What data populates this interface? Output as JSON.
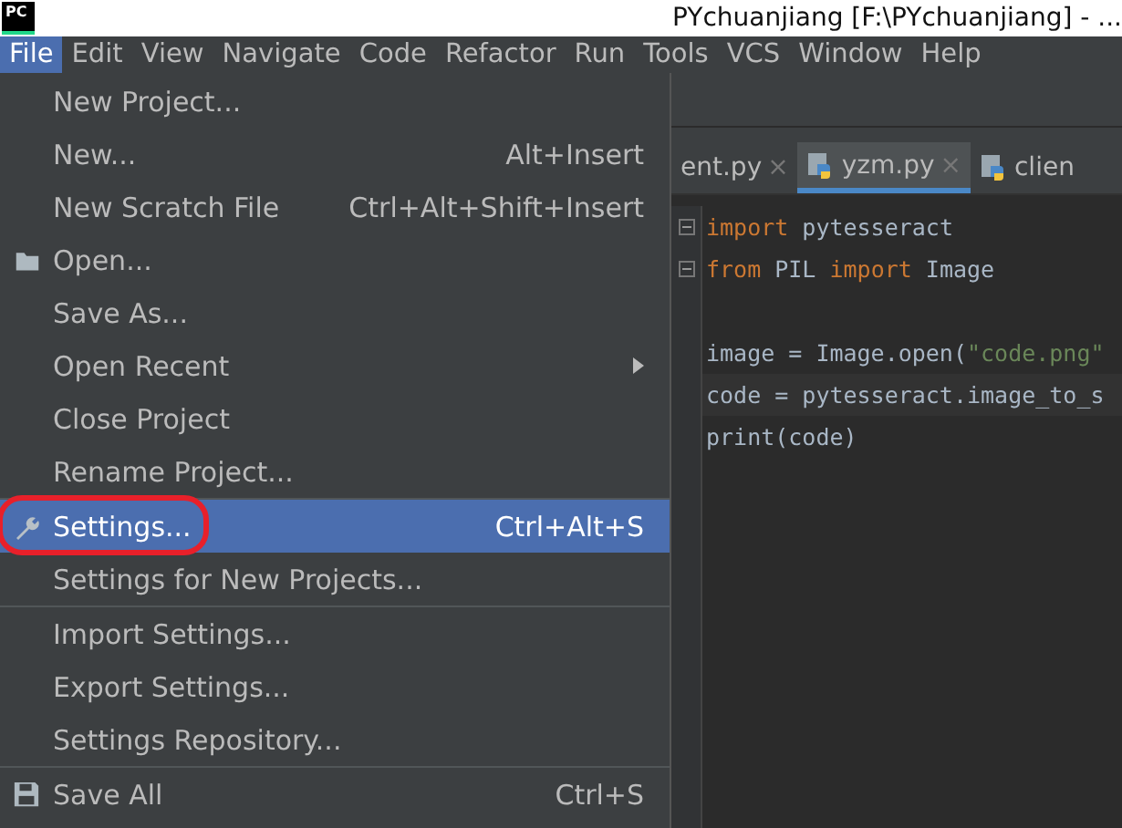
{
  "window": {
    "logo": "PC",
    "title": "PYchuanjiang [F:\\PYchuanjiang] - ..."
  },
  "menu_bar": [
    {
      "label": "File",
      "selected": true
    },
    {
      "label": "Edit",
      "selected": false
    },
    {
      "label": "View",
      "selected": false
    },
    {
      "label": "Navigate",
      "selected": false
    },
    {
      "label": "Code",
      "selected": false
    },
    {
      "label": "Refactor",
      "selected": false
    },
    {
      "label": "Run",
      "selected": false
    },
    {
      "label": "Tools",
      "selected": false
    },
    {
      "label": "VCS",
      "selected": false
    },
    {
      "label": "Window",
      "selected": false
    },
    {
      "label": "Help",
      "selected": false
    }
  ],
  "file_menu": [
    {
      "label": "New Project...",
      "selected": false
    },
    {
      "label": "New...",
      "shortcut": "Alt+Insert",
      "selected": false
    },
    {
      "label": "New Scratch File",
      "shortcut": "Ctrl+Alt+Shift+Insert",
      "selected": false
    },
    {
      "label": "Open...",
      "selected": false
    },
    {
      "label": "Save As...",
      "selected": false
    },
    {
      "label": "Open Recent",
      "submenu": true,
      "selected": false
    },
    {
      "label": "Close Project",
      "selected": false
    },
    {
      "label": "Rename Project...",
      "separator_after": true,
      "selected": false
    },
    {
      "label": "Settings...",
      "shortcut": "Ctrl+Alt+S",
      "selected": true,
      "circled": true
    },
    {
      "label": "Settings for New Projects...",
      "separator_after": true,
      "selected": false
    },
    {
      "label": "Import Settings...",
      "selected": false
    },
    {
      "label": "Export Settings...",
      "selected": false
    },
    {
      "label": "Settings Repository...",
      "separator_after": true,
      "selected": false
    },
    {
      "label": "Save All",
      "shortcut": "Ctrl+S",
      "selected": false
    }
  ],
  "editor_tabs": [
    {
      "label": "ent.py",
      "close": "×",
      "python": false,
      "selected": false
    },
    {
      "label": "yzm.py",
      "close": "×",
      "python": true,
      "selected": true
    },
    {
      "label": "clien",
      "python": true,
      "selected": false
    }
  ],
  "code_lines": [
    {
      "kind": "code",
      "fold": true,
      "tokens": [
        {
          "text": "import",
          "kind": "keyword"
        },
        {
          "text": " pytesseract",
          "kind": "plain"
        }
      ]
    },
    {
      "kind": "code",
      "fold": true,
      "tokens": [
        {
          "text": "from",
          "kind": "keyword"
        },
        {
          "text": " PIL ",
          "kind": "plain"
        },
        {
          "text": "import",
          "kind": "keyword"
        },
        {
          "text": " Image",
          "kind": "plain"
        }
      ]
    },
    {
      "kind": "blank"
    },
    {
      "kind": "code",
      "tokens": [
        {
          "text": "image = Image.open(",
          "kind": "plain"
        },
        {
          "text": "\"code.png\"",
          "kind": "string"
        }
      ]
    },
    {
      "kind": "code",
      "current": true,
      "tokens": [
        {
          "text": "code = pytesseract.image_to_s",
          "kind": "plain"
        }
      ]
    },
    {
      "kind": "code",
      "tokens": [
        {
          "text": "print(code)",
          "kind": "plain"
        }
      ]
    }
  ]
}
